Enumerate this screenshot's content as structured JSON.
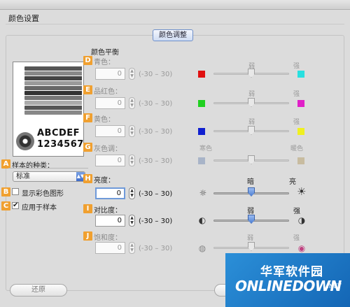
{
  "window": {
    "title": "颜色设置"
  },
  "tab": {
    "label": "颜色调整"
  },
  "preview": {
    "line1": "ABCDEF",
    "line2": "1234567"
  },
  "color_balance": {
    "heading": "颜色平衡",
    "rows": [
      {
        "badge": "D",
        "label": "青色：",
        "value": "0",
        "range": "(-30 – 30)",
        "low_label": "弱",
        "high_label": "强",
        "low_color": "#e01010",
        "high_color": "#28e0e0",
        "level": 0
      },
      {
        "badge": "E",
        "label": "品红色：",
        "value": "0",
        "range": "(-30 – 30)",
        "low_label": "弱",
        "high_label": "强",
        "low_color": "#20d020",
        "high_color": "#e020c8",
        "level": 0
      },
      {
        "badge": "F",
        "label": "黄色：",
        "value": "0",
        "range": "(-30 – 30)",
        "low_label": "弱",
        "high_label": "强",
        "low_color": "#1020d0",
        "high_color": "#f0f020",
        "level": 0
      },
      {
        "badge": "G",
        "label": "灰色调：",
        "value": "0",
        "range": "(-30 – 30)",
        "low_label": "寒色",
        "high_label": "暖色",
        "low_color": "#a8b4c8",
        "high_color": "#c8bca0",
        "level": 0
      }
    ]
  },
  "sample_type": {
    "badge": "A",
    "label": "样本的种类：",
    "selected": "标准"
  },
  "show_pattern": {
    "badge": "B",
    "label": "显示彩色图形",
    "checked": false
  },
  "apply_to_sample": {
    "badge": "C",
    "label": "应用于样本",
    "checked": true
  },
  "adjust": {
    "rows": [
      {
        "badge": "H",
        "label": "亮度：",
        "value": "0",
        "range": "(-30 – 30)",
        "low_label": "暗",
        "high_label": "亮",
        "low_icon": "brightness-low-icon",
        "high_icon": "brightness-high-icon",
        "level": 0
      },
      {
        "badge": "I",
        "label": "对比度：",
        "value": "0",
        "range": "(-30 – 30)",
        "low_label": "弱",
        "high_label": "强",
        "low_icon": "contrast-low-icon",
        "high_icon": "contrast-high-icon",
        "level": 0
      },
      {
        "badge": "J",
        "label": "饱和度：",
        "value": "0",
        "range": "(-30 – 30)",
        "low_label": "弱",
        "high_label": "强",
        "low_icon": "saturation-low-icon",
        "high_icon": "saturation-high-icon",
        "level": 0
      }
    ]
  },
  "buttons": {
    "restore": "还原"
  },
  "watermark": {
    "cn": "华军软件园",
    "en": "ONLINEDOWN",
    "suffix": ".NET"
  }
}
